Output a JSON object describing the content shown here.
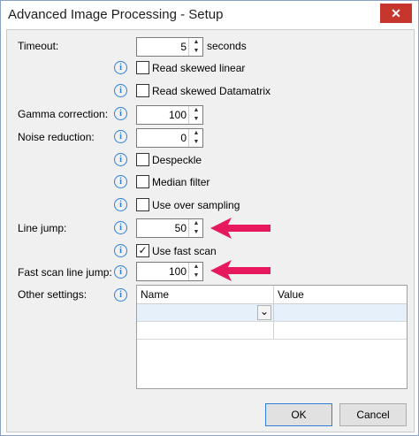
{
  "window": {
    "title": "Advanced Image Processing - Setup",
    "close_glyph": "✕"
  },
  "form": {
    "timeout": {
      "label": "Timeout:",
      "value": "5",
      "unit": "seconds"
    },
    "read_skewed_linear": {
      "label": "Read skewed linear",
      "checked": false
    },
    "read_skewed_datamatrix": {
      "label": "Read skewed Datamatrix",
      "checked": false
    },
    "gamma_correction": {
      "label": "Gamma correction:",
      "value": "100"
    },
    "noise_reduction": {
      "label": "Noise reduction:",
      "value": "0"
    },
    "despeckle": {
      "label": "Despeckle",
      "checked": false
    },
    "median_filter": {
      "label": "Median filter",
      "checked": false
    },
    "use_over_sampling": {
      "label": "Use over sampling",
      "checked": false
    },
    "line_jump": {
      "label": "Line jump:",
      "value": "50"
    },
    "use_fast_scan": {
      "label": "Use fast scan",
      "checked": true,
      "mark": "✓"
    },
    "fast_scan_line_jump": {
      "label": "Fast scan line jump:",
      "value": "100"
    },
    "other_settings": {
      "label": "Other settings:"
    }
  },
  "grid": {
    "columns": [
      "Name",
      "Value"
    ],
    "dropdown_glyph": "⌄"
  },
  "icons": {
    "info": "i",
    "spin_up": "▲",
    "spin_down": "▼"
  },
  "buttons": {
    "ok": "OK",
    "cancel": "Cancel"
  },
  "colors": {
    "annotation_arrow": "#e8185f",
    "info_icon": "#2f7fd8",
    "close_button": "#c7362c"
  }
}
